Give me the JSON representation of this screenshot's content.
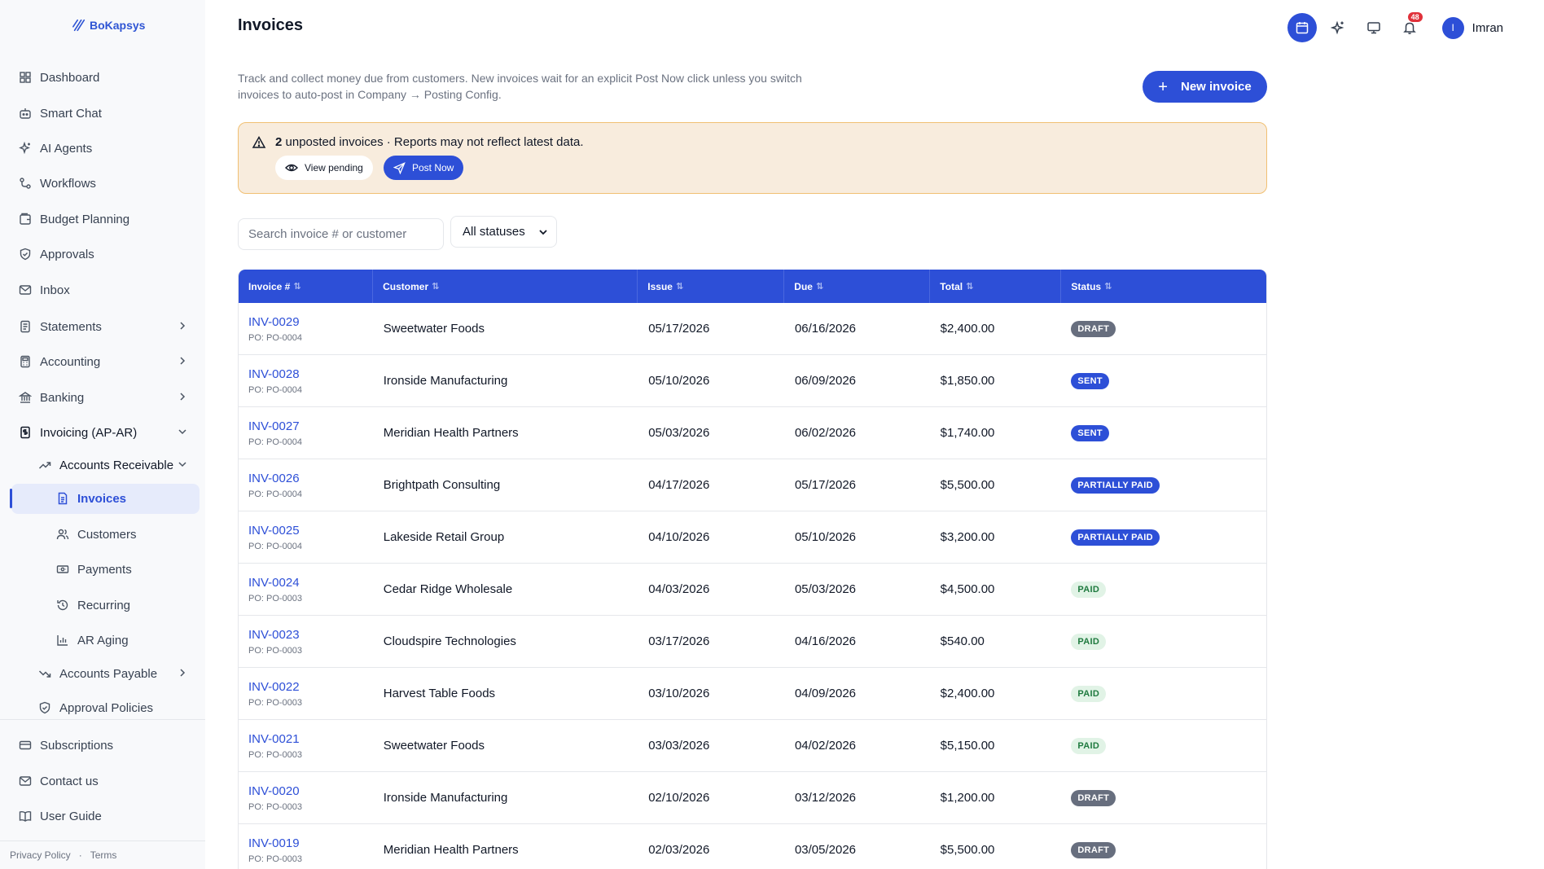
{
  "app": {
    "brand": "BoKapsys"
  },
  "sidebar": {
    "items": [
      {
        "label": "Dashboard",
        "icon": "grid-icon"
      },
      {
        "label": "Smart Chat",
        "icon": "bot-icon"
      },
      {
        "label": "AI Agents",
        "icon": "sparkles-icon"
      },
      {
        "label": "Workflows",
        "icon": "workflow-icon"
      },
      {
        "label": "Budget Planning",
        "icon": "wallet-icon"
      },
      {
        "label": "Approvals",
        "icon": "shield-icon"
      },
      {
        "label": "Inbox",
        "icon": "mail-icon"
      },
      {
        "label": "Statements",
        "icon": "document-icon"
      },
      {
        "label": "Accounting",
        "icon": "calculator-icon"
      },
      {
        "label": "Banking",
        "icon": "bank-icon"
      },
      {
        "label": "Invoicing (AP-AR)",
        "icon": "invoice-icon"
      }
    ],
    "ar_group": "Accounts Receivable",
    "ar_items": [
      {
        "label": "Invoices",
        "icon": "file-icon"
      },
      {
        "label": "Customers",
        "icon": "users-icon"
      },
      {
        "label": "Payments",
        "icon": "banknote-icon"
      },
      {
        "label": "Recurring",
        "icon": "history-icon"
      },
      {
        "label": "AR Aging",
        "icon": "bar-chart-icon"
      }
    ],
    "ap_group": "Accounts Payable",
    "approval_policies": "Approval Policies",
    "bottom_items": [
      {
        "label": "Subscriptions",
        "icon": "card-icon"
      },
      {
        "label": "Contact us",
        "icon": "mail-icon"
      },
      {
        "label": "User Guide",
        "icon": "book-icon"
      }
    ],
    "legal": {
      "privacy": "Privacy Policy",
      "sep": "·",
      "terms": "Terms"
    }
  },
  "header": {
    "title": "Invoices",
    "notification_count": "48",
    "user_initial": "I",
    "user_name": "Imran"
  },
  "page": {
    "description": "Track and collect money due from customers. New invoices wait for an explicit Post Now click unless you switch invoices to auto-post in Company → Posting Config.",
    "new_invoice_label": "New invoice"
  },
  "alert": {
    "count": "2",
    "message": " unposted invoices · Reports may not reflect latest data.",
    "view_pending_label": "View pending",
    "post_now_label": "Post Now"
  },
  "filters": {
    "search_placeholder": "Search invoice # or customer",
    "status_value": "All statuses"
  },
  "table": {
    "columns": [
      "Invoice #",
      "Customer",
      "Issue",
      "Due",
      "Total",
      "Status"
    ],
    "rows": [
      {
        "invoice": "INV-0029",
        "po": "PO: PO-0004",
        "customer": "Sweetwater Foods",
        "issue": "05/17/2026",
        "due": "06/16/2026",
        "total": "$2,400.00",
        "status": "DRAFT",
        "kind": "draft"
      },
      {
        "invoice": "INV-0028",
        "po": "PO: PO-0004",
        "customer": "Ironside Manufacturing",
        "issue": "05/10/2026",
        "due": "06/09/2026",
        "total": "$1,850.00",
        "status": "SENT",
        "kind": "sent"
      },
      {
        "invoice": "INV-0027",
        "po": "PO: PO-0004",
        "customer": "Meridian Health Partners",
        "issue": "05/03/2026",
        "due": "06/02/2026",
        "total": "$1,740.00",
        "status": "SENT",
        "kind": "sent"
      },
      {
        "invoice": "INV-0026",
        "po": "PO: PO-0004",
        "customer": "Brightpath Consulting",
        "issue": "04/17/2026",
        "due": "05/17/2026",
        "total": "$5,500.00",
        "status": "PARTIALLY PAID",
        "kind": "partial"
      },
      {
        "invoice": "INV-0025",
        "po": "PO: PO-0004",
        "customer": "Lakeside Retail Group",
        "issue": "04/10/2026",
        "due": "05/10/2026",
        "total": "$3,200.00",
        "status": "PARTIALLY PAID",
        "kind": "partial"
      },
      {
        "invoice": "INV-0024",
        "po": "PO: PO-0003",
        "customer": "Cedar Ridge Wholesale",
        "issue": "04/03/2026",
        "due": "05/03/2026",
        "total": "$4,500.00",
        "status": "PAID",
        "kind": "paid"
      },
      {
        "invoice": "INV-0023",
        "po": "PO: PO-0003",
        "customer": "Cloudspire Technologies",
        "issue": "03/17/2026",
        "due": "04/16/2026",
        "total": "$540.00",
        "status": "PAID",
        "kind": "paid"
      },
      {
        "invoice": "INV-0022",
        "po": "PO: PO-0003",
        "customer": "Harvest Table Foods",
        "issue": "03/10/2026",
        "due": "04/09/2026",
        "total": "$2,400.00",
        "status": "PAID",
        "kind": "paid"
      },
      {
        "invoice": "INV-0021",
        "po": "PO: PO-0003",
        "customer": "Sweetwater Foods",
        "issue": "03/03/2026",
        "due": "04/02/2026",
        "total": "$5,150.00",
        "status": "PAID",
        "kind": "paid"
      },
      {
        "invoice": "INV-0020",
        "po": "PO: PO-0003",
        "customer": "Ironside Manufacturing",
        "issue": "02/10/2026",
        "due": "03/12/2026",
        "total": "$1,200.00",
        "status": "DRAFT",
        "kind": "draft"
      },
      {
        "invoice": "INV-0019",
        "po": "PO: PO-0003",
        "customer": "Meridian Health Partners",
        "issue": "02/03/2026",
        "due": "03/05/2026",
        "total": "$5,500.00",
        "status": "DRAFT",
        "kind": "draft"
      }
    ]
  }
}
